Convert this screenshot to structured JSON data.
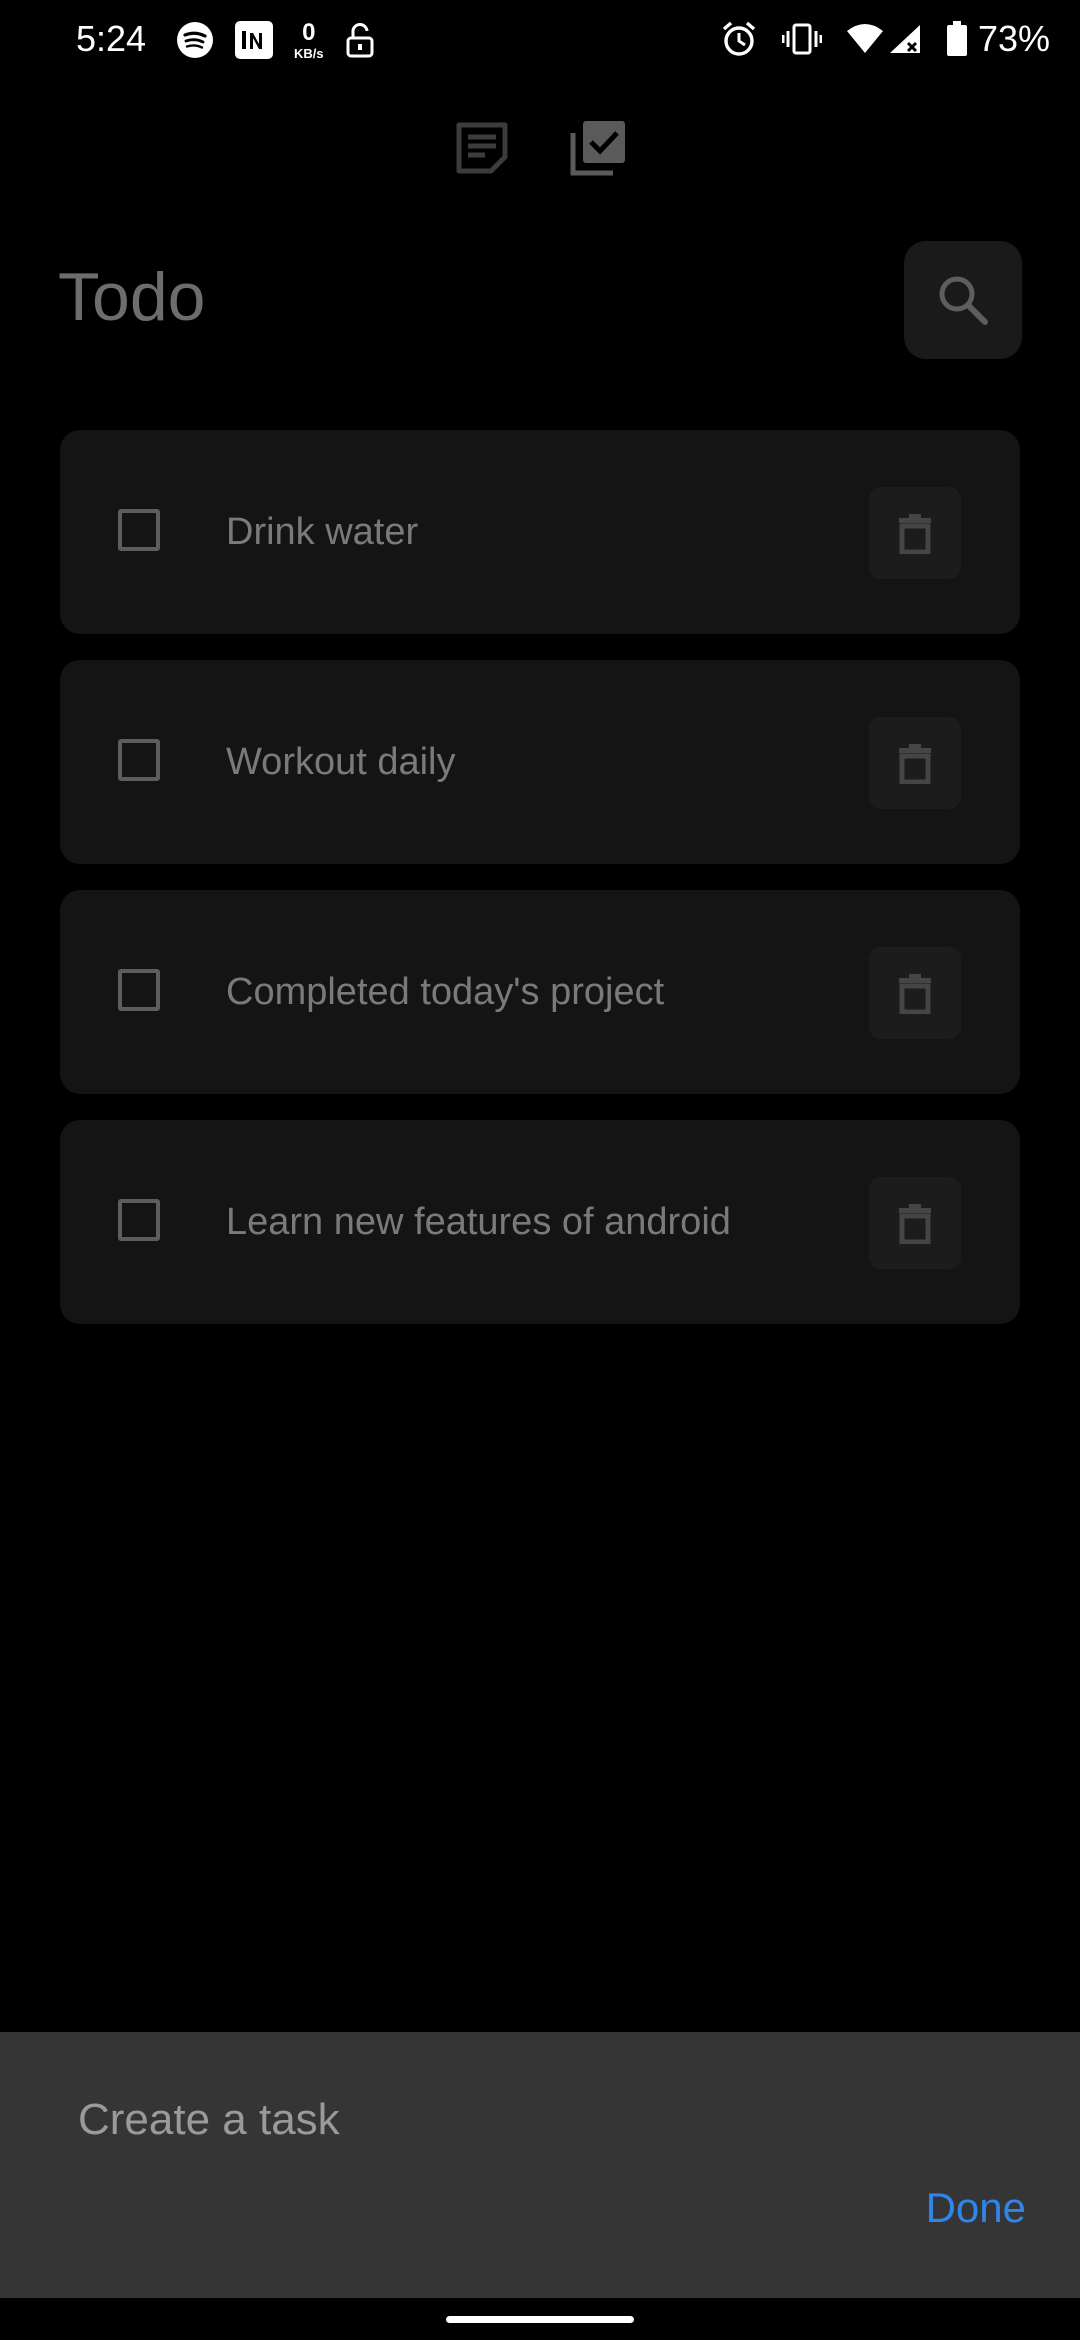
{
  "status_bar": {
    "time": "5:24",
    "net_speed_value": "0",
    "net_speed_unit": "KB/s",
    "battery_percent": "73%",
    "left_icons": [
      "spotify-icon",
      "inshorts-icon",
      "unlock-icon"
    ],
    "right_icons": [
      "alarm-icon",
      "vibrate-icon",
      "wifi-icon",
      "cellular-signal-icon",
      "battery-icon"
    ]
  },
  "top_tabs": [
    {
      "icon": "notes-icon",
      "active": false
    },
    {
      "icon": "checklist-icon",
      "active": true
    }
  ],
  "header": {
    "title": "Todo",
    "search_icon": "search-icon"
  },
  "tasks": [
    {
      "label": "Drink water",
      "checked": false
    },
    {
      "label": "Workout daily",
      "checked": false
    },
    {
      "label": "Completed today's project",
      "checked": false
    },
    {
      "label": "Learn new features of android",
      "checked": false
    }
  ],
  "composer": {
    "placeholder": "Create a task",
    "value": "",
    "done_label": "Done"
  },
  "colors": {
    "background": "#000000",
    "card": "#141414",
    "accent": "#2f86e8",
    "panel": "#353535"
  }
}
